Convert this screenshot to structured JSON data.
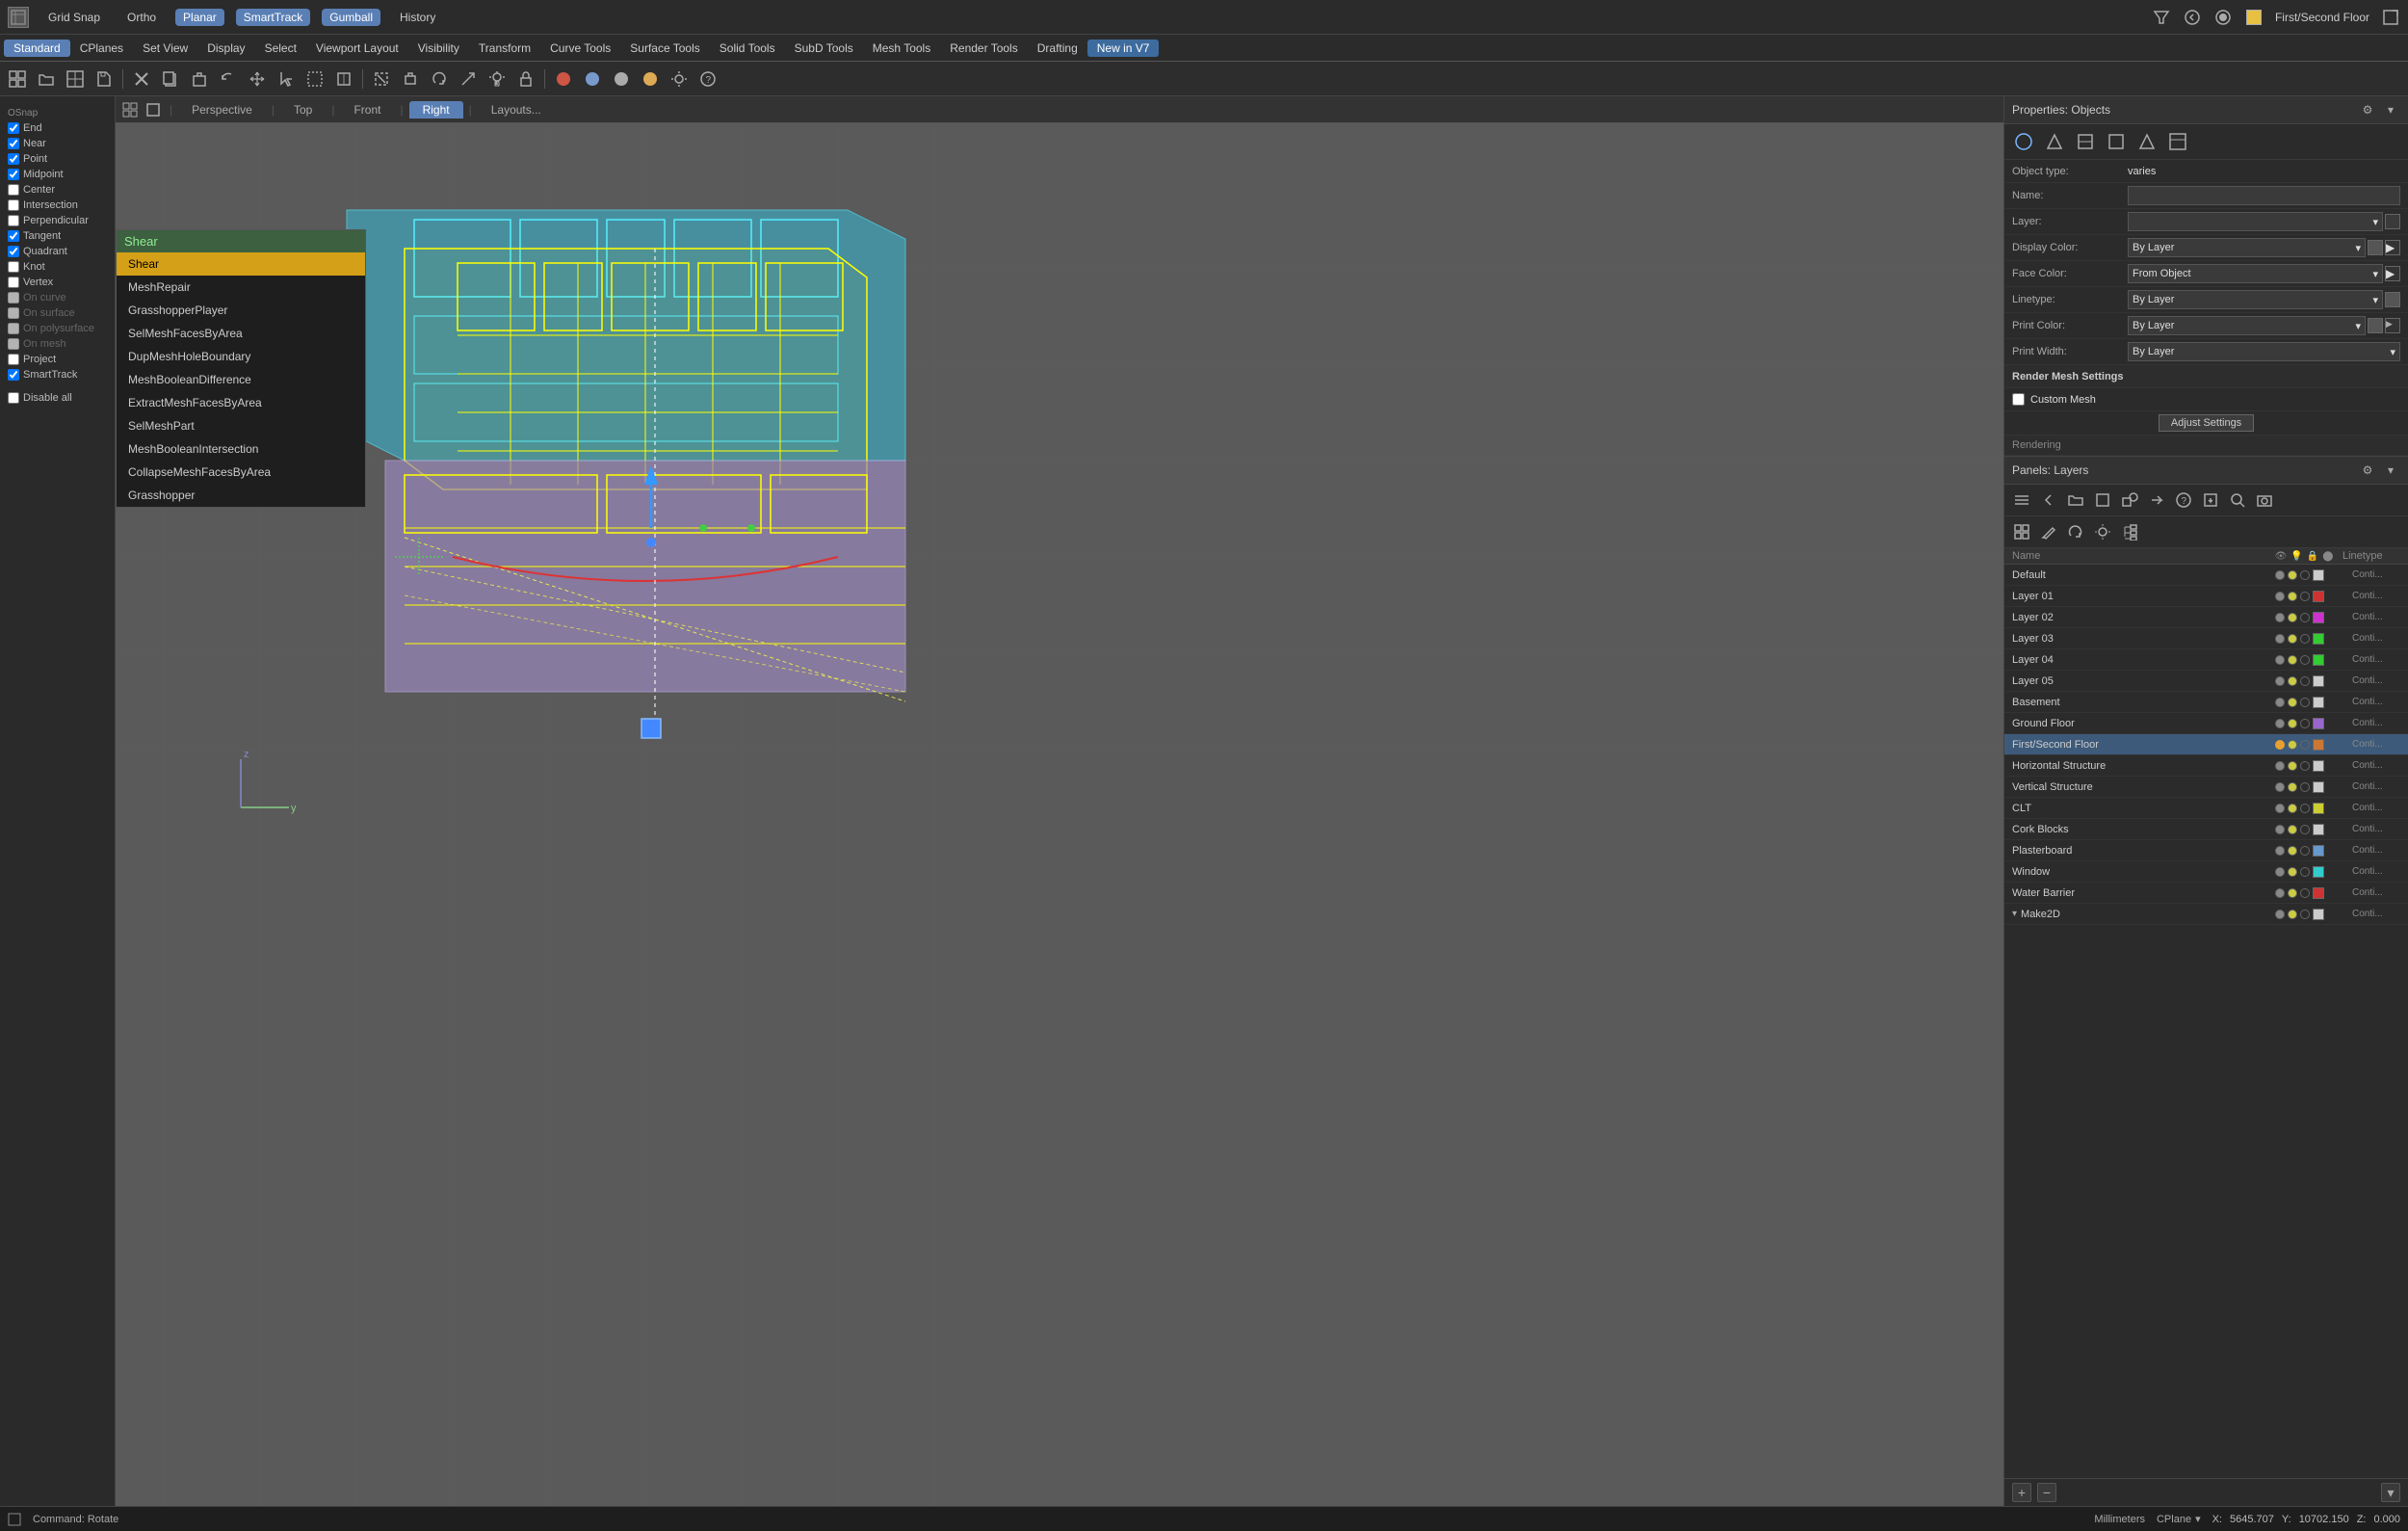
{
  "topbar": {
    "grid_snap": "Grid Snap",
    "ortho": "Ortho",
    "planar": "Planar",
    "smart_track": "SmartTrack",
    "gumball": "Gumball",
    "history": "History",
    "viewport_name": "First/Second Floor"
  },
  "menubar": {
    "items": [
      "Standard",
      "CPlanes",
      "Set View",
      "Display",
      "Select",
      "Viewport Layout",
      "Visibility",
      "Transform",
      "Curve Tools",
      "Surface Tools",
      "Solid Tools",
      "SubD Tools",
      "Mesh Tools",
      "Render Tools",
      "Drafting",
      "New in V7"
    ]
  },
  "viewport_tabs": {
    "tabs": [
      "Perspective",
      "Top",
      "Front",
      "Right",
      "Layouts..."
    ],
    "active": "Right"
  },
  "command_input": {
    "value": "Shear",
    "placeholder": "Shear"
  },
  "dropdown_items": [
    {
      "label": "Shear",
      "selected": true
    },
    {
      "label": "MeshRepair",
      "selected": false
    },
    {
      "label": "GrasshopperPlayer",
      "selected": false
    },
    {
      "label": "SelMeshFacesByArea",
      "selected": false
    },
    {
      "label": "DupMeshHoleBoundary",
      "selected": false
    },
    {
      "label": "MeshBooleanDifference",
      "selected": false
    },
    {
      "label": "ExtractMeshFacesByArea",
      "selected": false
    },
    {
      "label": "SelMeshPart",
      "selected": false
    },
    {
      "label": "MeshBooleanIntersection",
      "selected": false
    },
    {
      "label": "CollapseMeshFacesByArea",
      "selected": false
    },
    {
      "label": "Grasshopper",
      "selected": false
    }
  ],
  "snap_panel": {
    "items": [
      {
        "label": "End",
        "checked": true
      },
      {
        "label": "Near",
        "checked": true
      },
      {
        "label": "Point",
        "checked": true
      },
      {
        "label": "Midpoint",
        "checked": true
      },
      {
        "label": "Center",
        "checked": false
      },
      {
        "label": "Intersection",
        "checked": false
      },
      {
        "label": "Perpendicular",
        "checked": false
      },
      {
        "label": "Tangent",
        "checked": true
      },
      {
        "label": "Quadrant",
        "checked": true
      },
      {
        "label": "Knot",
        "checked": false
      },
      {
        "label": "Vertex",
        "checked": false
      },
      {
        "label": "On curve",
        "checked": false,
        "disabled": true
      },
      {
        "label": "On surface",
        "checked": false,
        "disabled": true
      },
      {
        "label": "On polysurface",
        "checked": false,
        "disabled": true
      },
      {
        "label": "On mesh",
        "checked": false,
        "disabled": true
      },
      {
        "label": "Project",
        "checked": false
      },
      {
        "label": "SmartTrack",
        "checked": true
      },
      {
        "label": "Disable all",
        "checked": false
      }
    ]
  },
  "properties": {
    "title": "Properties: Objects",
    "object_type_label": "Object type:",
    "object_type_value": "varies",
    "name_label": "Name:",
    "name_value": "",
    "layer_label": "Layer:",
    "layer_value": "",
    "display_color_label": "Display Color:",
    "display_color_value": "By Layer",
    "face_color_label": "Face Color:",
    "face_color_value": "From Object",
    "linetype_label": "Linetype:",
    "linetype_value": "By Layer",
    "print_color_label": "Print Color:",
    "print_color_value": "By Layer",
    "print_width_label": "Print Width:",
    "print_width_value": "By Layer",
    "render_mesh_label": "Render Mesh Settings",
    "custom_mesh_label": "Custom Mesh",
    "adjust_settings_label": "Adjust Settings",
    "rendering_label": "Rendering"
  },
  "layers": {
    "title": "Panels: Layers",
    "header_cols": [
      "Name",
      "Linetype"
    ],
    "items": [
      {
        "name": "Default",
        "active": false,
        "color": "white",
        "linetype": "Conti..."
      },
      {
        "name": "Layer 01",
        "active": false,
        "color": "red",
        "linetype": "Conti..."
      },
      {
        "name": "Layer 02",
        "active": false,
        "color": "magenta",
        "linetype": "Conti..."
      },
      {
        "name": "Layer 03",
        "active": false,
        "color": "green",
        "linetype": "Conti..."
      },
      {
        "name": "Layer 04",
        "active": false,
        "color": "green",
        "linetype": "Conti..."
      },
      {
        "name": "Layer 05",
        "active": false,
        "color": "white",
        "linetype": "Conti..."
      },
      {
        "name": "Basement",
        "active": false,
        "color": "white",
        "linetype": "Conti..."
      },
      {
        "name": "Ground Floor",
        "active": false,
        "color": "lt-purple",
        "linetype": "Conti..."
      },
      {
        "name": "First/Second Floor",
        "active": true,
        "color": "orange",
        "linetype": "Conti..."
      },
      {
        "name": "Horizontal Structure",
        "active": false,
        "color": "white",
        "linetype": "Conti..."
      },
      {
        "name": "Vertical Structure",
        "active": false,
        "color": "white",
        "linetype": "Conti..."
      },
      {
        "name": "CLT",
        "active": false,
        "color": "yellow",
        "linetype": "Conti..."
      },
      {
        "name": "Cork Blocks",
        "active": false,
        "color": "white",
        "linetype": "Conti..."
      },
      {
        "name": "Plasterboard",
        "active": false,
        "color": "lt-blue",
        "linetype": "Conti..."
      },
      {
        "name": "Window",
        "active": false,
        "color": "cyan",
        "linetype": "Conti..."
      },
      {
        "name": "Water Barrier",
        "active": false,
        "color": "red",
        "linetype": "Conti..."
      },
      {
        "name": "Make2D",
        "active": false,
        "color": "white",
        "linetype": "Conti...",
        "indent": true
      }
    ]
  },
  "statusbar": {
    "command_label": "Command: Rotate",
    "units": "Millimeters",
    "cplane": "CPlane",
    "x_label": "X:",
    "x_value": "5645.707",
    "y_label": "Y:",
    "y_value": "10702.150",
    "z_label": "Z:",
    "z_value": "0.000"
  }
}
